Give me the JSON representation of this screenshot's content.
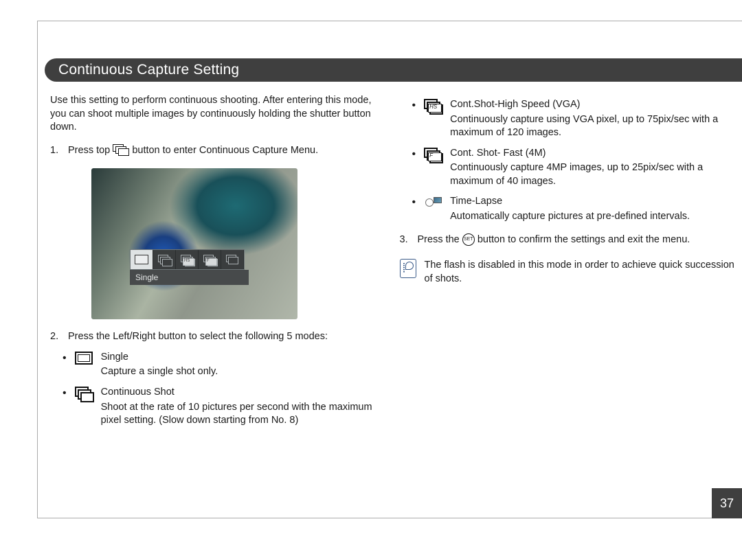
{
  "title": "Continuous Capture Setting",
  "intro": "Use this setting to perform continuous shooting. After entering this mode, you can shoot multiple images by continuously holding the shutter button down.",
  "step1": {
    "num": "1.",
    "a": "Press top",
    "b": "button to enter Continuous Capture Menu."
  },
  "screenshot_label": "Single",
  "step2": {
    "num": "2.",
    "text": "Press the Left/Right button to select the following 5 modes:"
  },
  "modes_left": [
    {
      "title": "Single",
      "desc": "Capture a single shot only.",
      "icon": "single"
    },
    {
      "title": "Continuous Shot",
      "desc": "Shoot at the rate of 10 pictures per second with the maximum pixel setting. (Slow down starting from No. 8)",
      "icon": "stack"
    }
  ],
  "modes_right": [
    {
      "title": "Cont.Shot-High Speed (VGA)",
      "desc": "Continuously capture using VGA pixel, up to 75pix/sec with a maximum of 120 images.",
      "icon": "stack",
      "tag": "HS"
    },
    {
      "title": "Cont. Shot- Fast (4M)",
      "desc": "Continuously capture 4MP images, up to 25pix/sec with a maximum of 40 images.",
      "icon": "stack",
      "tag": "F"
    },
    {
      "title": "Time-Lapse",
      "desc": "Automatically capture pictures at pre-defined intervals.",
      "icon": "timelapse"
    }
  ],
  "step3": {
    "num": "3.",
    "a": "Press the",
    "b": "button to confirm the settings and exit the menu.",
    "set": "SET"
  },
  "note": "The flash is disabled in this mode in order to achieve quick succession of shots.",
  "page": "37"
}
